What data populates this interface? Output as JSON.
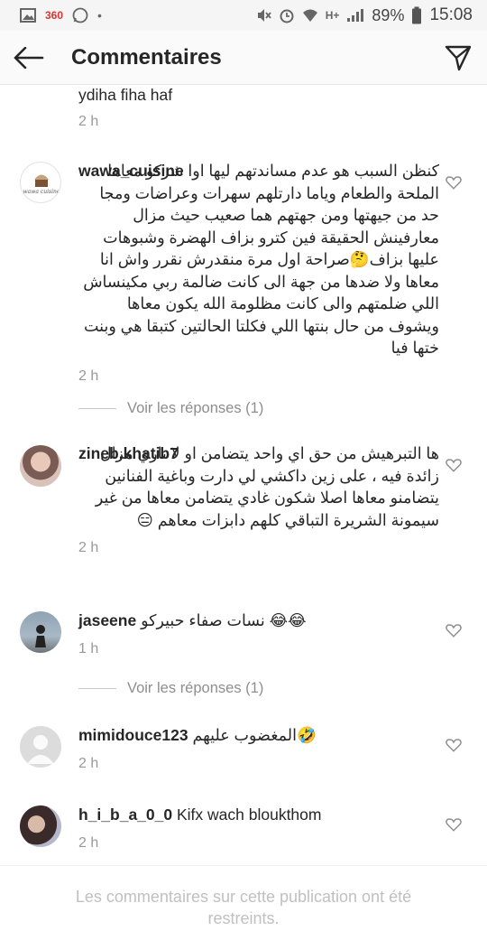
{
  "statusbar": {
    "left_badge": "360",
    "battery": "89%",
    "time": "15:08",
    "network": "H+"
  },
  "header": {
    "title": "Commentaires"
  },
  "comments": [
    {
      "username": "",
      "text": "ydiha fiha haf",
      "time": "2 h"
    },
    {
      "username": "wawa_cuisine",
      "text": "كنظن السبب هو عدم مساندتهم ليها اوا شركو معاها الملحة والطعام وياما دارتلهم سهرات وعراضات ومجا حد من جيهتها ومن جهتهم هما صعيب حيث مزال معارفينش الحقيقة فين كترو بزاف الهضرة وشبوهات عليها بزاف🤔صراحة اول مرة منقدرش نقرر واش انا معاها ولا ضدها من جهة الى كانت ضالمة ربي مكينساش اللي ضلمتهم والى كانت مظلومة الله يكون معاها ويشوف من حال بنتها اللي فكلتا الحالتين كتبقا هي وبنت ختها فيا",
      "time": "2 h",
      "avatar_label": "wawa cuisine"
    },
    {
      "username": "zineb.khatib7",
      "text": "ها التبرهيش من حق اي واحد يتضامن او لا ناري مزال زائدة فيه ، على زين داكشي لي دارت وباغية الفنانين يتضامنو معاها اصلا شكون غادي يتضامن معاها من غير سيمونة الشريرة التباقي كلهم دابزات معاهم 😑",
      "time": "2 h"
    },
    {
      "username": "jaseene",
      "text": "نسات صفاء حبيركو 😂😂",
      "time": "1 h"
    },
    {
      "username": "mimidouce123",
      "text": "المغضوب عليهم🤣",
      "time": "2 h"
    },
    {
      "username": "h_i_b_a_0_0",
      "text": "Kifx wach bloukthom",
      "time": "2 h"
    }
  ],
  "view_replies": [
    {
      "label": "Voir les réponses (1)"
    },
    {
      "label": "Voir les réponses (1)"
    }
  ],
  "footer": {
    "restricted_notice": "Les commentaires sur cette publication ont été restreints."
  },
  "colors": {
    "text": "#262626",
    "muted": "#999999",
    "divider": "#c7c7c7"
  }
}
